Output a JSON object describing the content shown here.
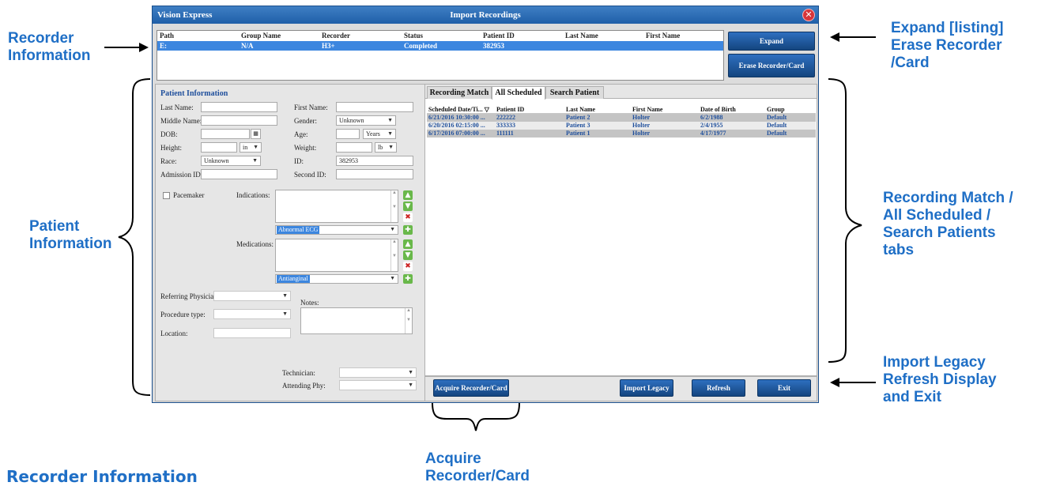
{
  "window": {
    "app_name": "Vision Express",
    "title": "Import Recordings",
    "close_glyph": "✕"
  },
  "recorder_table": {
    "columns": [
      "Path",
      "Group Name",
      "Recorder",
      "Status",
      "Patient ID",
      "Last Name",
      "First Name"
    ],
    "rows": [
      [
        "E:",
        "N/A",
        "H3+",
        "Completed",
        "382953",
        "",
        ""
      ]
    ]
  },
  "buttons": {
    "expand": "Expand",
    "erase": "Erase Recorder/Card",
    "acquire": "Acquire Recorder/Card",
    "import_legacy": "Import Legacy",
    "refresh": "Refresh",
    "exit": "Exit"
  },
  "patient": {
    "title": "Patient Information",
    "last_name_label": "Last Name:",
    "first_name_label": "First Name:",
    "middle_name_label": "Middle Name:",
    "gender_label": "Gender:",
    "gender_value": "Unknown",
    "dob_label": "DOB:",
    "age_label": "Age:",
    "age_unit": "Years",
    "height_label": "Height:",
    "height_unit": "in",
    "weight_label": "Weight:",
    "weight_unit": "lb",
    "race_label": "Race:",
    "race_value": "Unknown",
    "id_label": "ID:",
    "id_value": "382953",
    "admission_label": "Admission ID:",
    "second_id_label": "Second ID:",
    "pacemaker_label": "Pacemaker",
    "indications_label": "Indications:",
    "indications_value": "Abnormal ECG",
    "medications_label": "Medications:",
    "medications_value": "Antianginal",
    "referring_label": "Referring Physician:",
    "notes_label": "Notes:",
    "procedure_label": "Procedure type:",
    "location_label": "Location:",
    "technician_label": "Technician:",
    "attending_label": "Attending Phy:"
  },
  "tabs": [
    "Recording Match",
    "All Scheduled",
    "Search Patient"
  ],
  "active_tab": "All Scheduled",
  "schedule_table": {
    "columns": [
      "Scheduled Date/Ti...",
      "Patient ID",
      "Last Name",
      "First Name",
      "Date of Birth",
      "Group"
    ],
    "sort_glyph": "▽",
    "rows": [
      [
        "6/21/2016 10:30:00 ...",
        "222222",
        "Patient 2",
        "Holter",
        "6/2/1988",
        "Default"
      ],
      [
        "6/20/2016 02:15:00 ...",
        "333333",
        "Patient 3",
        "Holter",
        "2/4/1955",
        "Default"
      ],
      [
        "6/17/2016 07:00:00 ...",
        "111111",
        "Patient 1",
        "Holter",
        "4/17/1977",
        "Default"
      ]
    ]
  },
  "callouts": {
    "recorder_info": [
      "Recorder",
      "Information"
    ],
    "expand_erase": [
      "Expand [listing]",
      "Erase Recorder",
      "/Card"
    ],
    "patient_info": [
      "Patient",
      "Information"
    ],
    "tabs_info": [
      "Recording Match /",
      "All Scheduled /",
      "Search Patients",
      "tabs"
    ],
    "import_legacy": [
      "Import Legacy",
      "Refresh Display",
      "and Exit"
    ],
    "acquire": [
      "Acquire",
      "Recorder/Card"
    ]
  },
  "section_heading": "Recorder Information",
  "colors": {
    "callout": "#1f6fc6",
    "title_bar": "#1f5fa8",
    "selection": "#3c86df",
    "button": "#1a5aa6"
  }
}
